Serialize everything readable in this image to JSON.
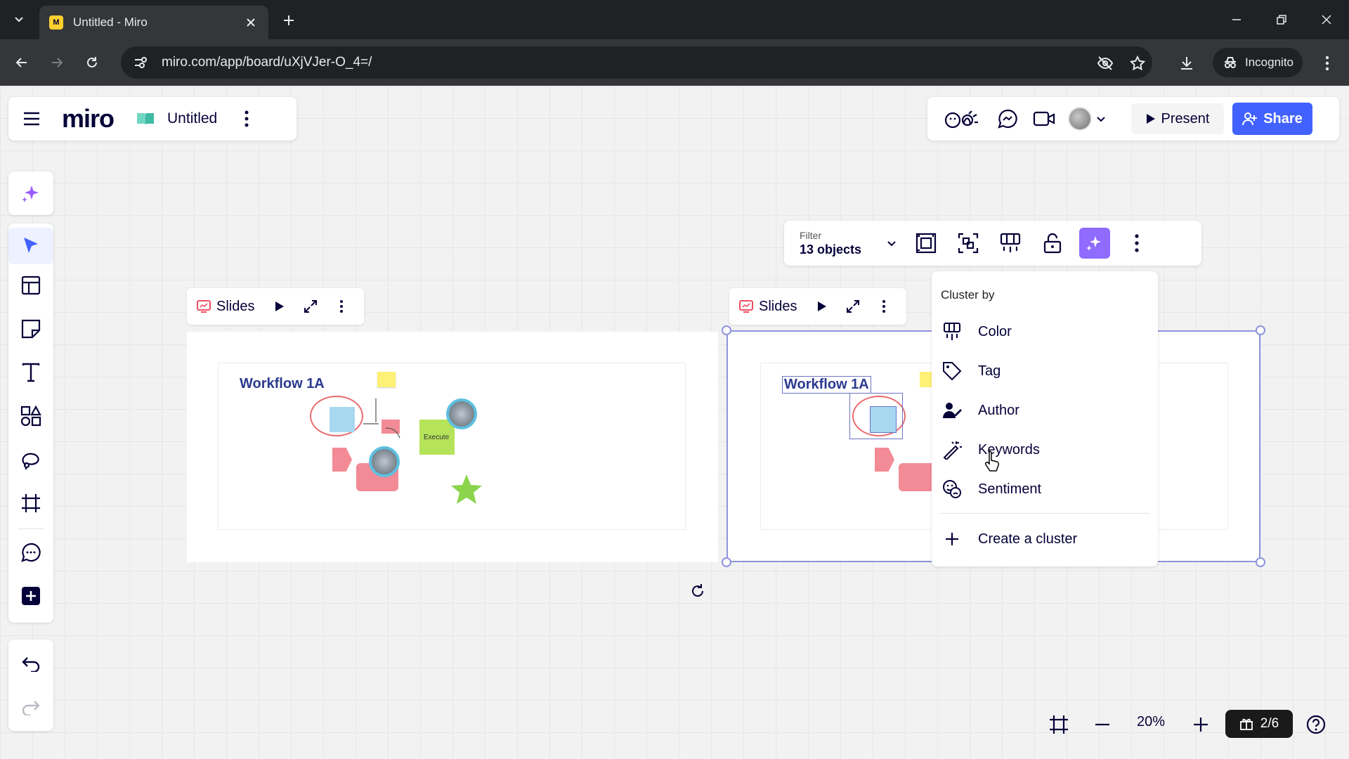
{
  "browser": {
    "tab_title": "Untitled - Miro",
    "url": "miro.com/app/board/uXjVJer-O_4=/",
    "incognito_label": "Incognito"
  },
  "board": {
    "logo": "miro",
    "name": "Untitled"
  },
  "topbar": {
    "present_label": "Present",
    "share_label": "Share"
  },
  "context_toolbar": {
    "filter_label": "Filter",
    "filter_value": "13 objects"
  },
  "slides": {
    "left_label": "Slides",
    "right_label": "Slides"
  },
  "frames": {
    "left_title": "Workflow 1A",
    "right_title": "Workflow 1A",
    "left_execute": "Execute"
  },
  "cluster_menu": {
    "header": "Cluster by",
    "items": [
      {
        "label": "Color",
        "icon": "color-palette-icon"
      },
      {
        "label": "Tag",
        "icon": "tag-icon"
      },
      {
        "label": "Author",
        "icon": "author-icon"
      },
      {
        "label": "Keywords",
        "icon": "magic-wand-icon"
      },
      {
        "label": "Sentiment",
        "icon": "sentiment-icon"
      }
    ],
    "create_label": "Create a cluster"
  },
  "bottom": {
    "zoom": "20%",
    "pages": "2/6"
  },
  "colors": {
    "accent": "#4262ff",
    "ai_purple": "#8f6bff",
    "selection": "#8d94dc"
  }
}
